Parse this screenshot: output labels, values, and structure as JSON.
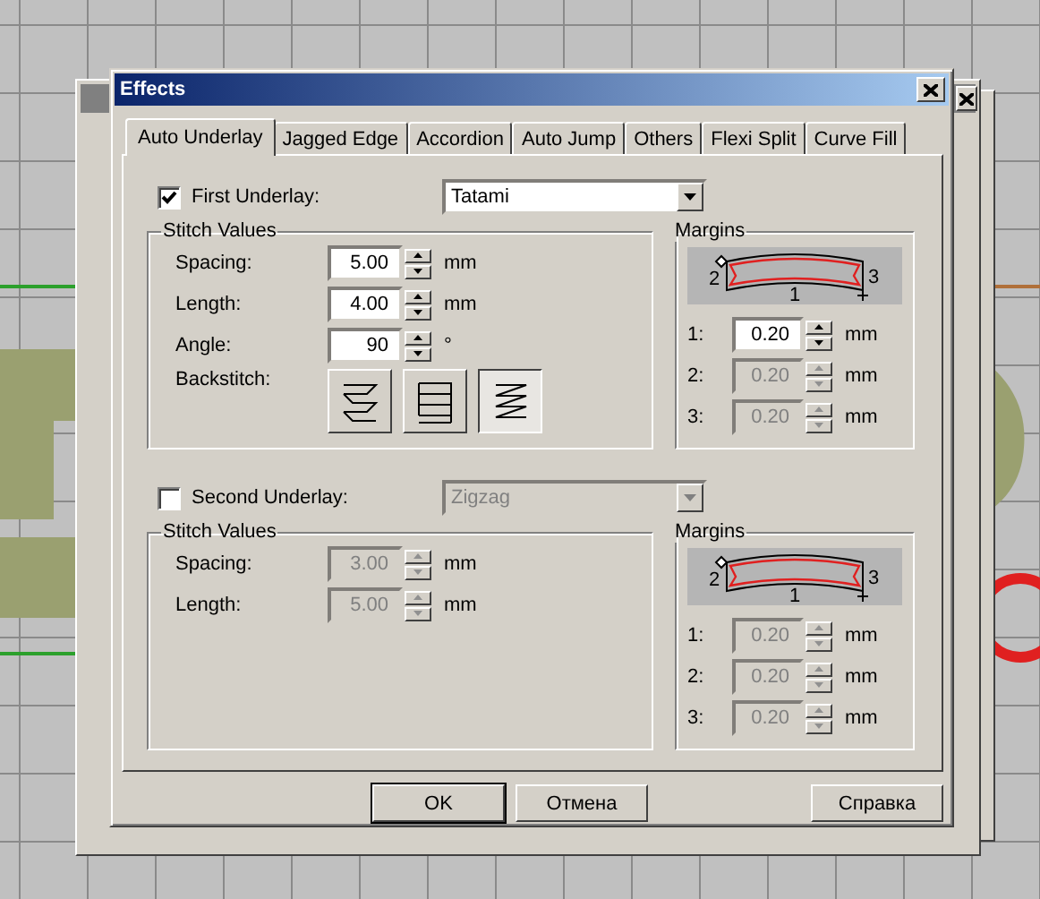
{
  "window": {
    "title": "Effects"
  },
  "tabs": [
    {
      "label": "Auto Underlay",
      "selected": true
    },
    {
      "label": "Jagged Edge",
      "selected": false
    },
    {
      "label": "Accordion",
      "selected": false
    },
    {
      "label": "Auto Jump",
      "selected": false
    },
    {
      "label": "Others",
      "selected": false
    },
    {
      "label": "Flexi Split",
      "selected": false
    },
    {
      "label": "Curve Fill",
      "selected": false
    }
  ],
  "underlays": [
    {
      "label": "First Underlay:",
      "checked": true,
      "type": "Tatami",
      "stitch_values": {
        "title": "Stitch Values",
        "fields": [
          {
            "label": "Spacing:",
            "value": "5.00",
            "unit": "mm",
            "disabled": false
          },
          {
            "label": "Length:",
            "value": "4.00",
            "unit": "mm",
            "disabled": false
          },
          {
            "label": "Angle:",
            "value": "90",
            "unit": "°",
            "disabled": false
          }
        ],
        "backstitch": {
          "label": "Backstitch:",
          "options": [
            {
              "kind": "slanted",
              "selected": false
            },
            {
              "kind": "straight",
              "selected": false
            },
            {
              "kind": "zigzag",
              "selected": true
            }
          ]
        }
      },
      "margins": {
        "title": "Margins",
        "diagram_labels": [
          "2",
          "1",
          "3"
        ],
        "fields": [
          {
            "label": "1:",
            "value": "0.20",
            "unit": "mm",
            "disabled": false
          },
          {
            "label": "2:",
            "value": "0.20",
            "unit": "mm",
            "disabled": true
          },
          {
            "label": "3:",
            "value": "0.20",
            "unit": "mm",
            "disabled": true
          }
        ]
      }
    },
    {
      "label": "Second Underlay:",
      "checked": false,
      "type": "Zigzag",
      "stitch_values": {
        "title": "Stitch Values",
        "fields": [
          {
            "label": "Spacing:",
            "value": "3.00",
            "unit": "mm",
            "disabled": true
          },
          {
            "label": "Length:",
            "value": "5.00",
            "unit": "mm",
            "disabled": true
          }
        ]
      },
      "margins": {
        "title": "Margins",
        "diagram_labels": [
          "2",
          "1",
          "3"
        ],
        "fields": [
          {
            "label": "1:",
            "value": "0.20",
            "unit": "mm",
            "disabled": true
          },
          {
            "label": "2:",
            "value": "0.20",
            "unit": "mm",
            "disabled": true
          },
          {
            "label": "3:",
            "value": "0.20",
            "unit": "mm",
            "disabled": true
          }
        ]
      }
    }
  ],
  "buttons": [
    {
      "label": "OK",
      "default": true
    },
    {
      "label": "Отмена",
      "default": false
    },
    {
      "label": "Справка",
      "default": false
    }
  ]
}
